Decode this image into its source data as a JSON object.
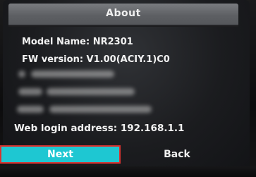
{
  "dialog": {
    "title": "About"
  },
  "info": {
    "model_name": "Model Name:  NR2301",
    "fw_version": "FW version:  V1.00(ACIY.1)C0",
    "web_login": "Web login address:  192.168.1.1"
  },
  "buttons": {
    "next_label": "Next",
    "back_label": "Back"
  },
  "colors": {
    "accent": "#1ec7d2",
    "focus_border": "#d9322f"
  }
}
